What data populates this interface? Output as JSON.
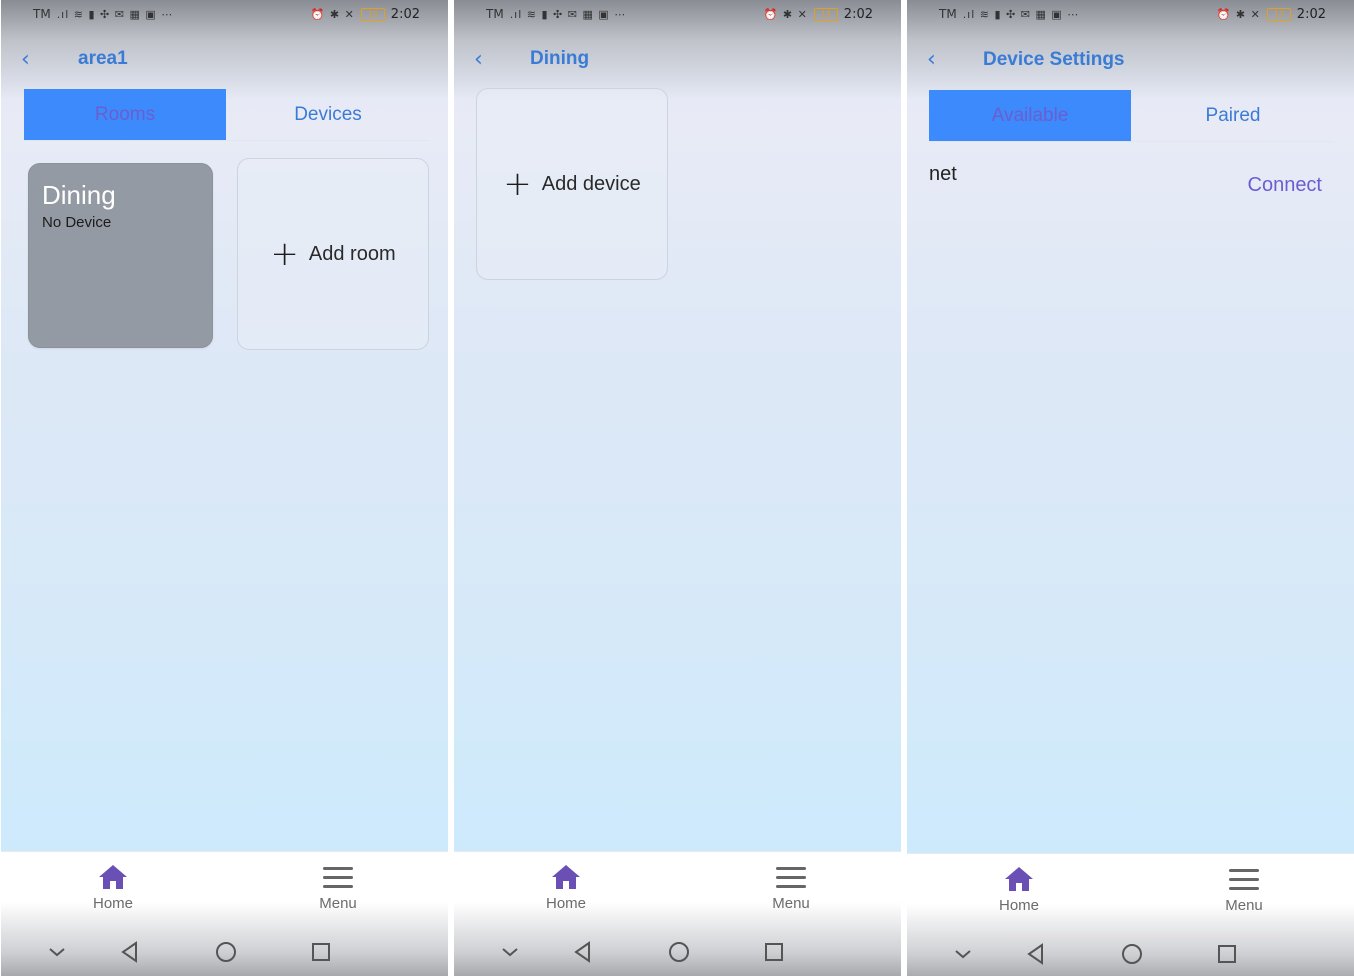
{
  "status": {
    "carrier": "TM",
    "time": "2:02",
    "battery": "13"
  },
  "screens": [
    {
      "title": "area1",
      "tabs": [
        {
          "label": "Rooms",
          "active": true
        },
        {
          "label": "Devices",
          "active": false
        }
      ],
      "room_card": {
        "name": "Dining",
        "sub": "No Device"
      },
      "add_label": "Add room"
    },
    {
      "title": "Dining",
      "add_label": "Add device"
    },
    {
      "title": "Device Settings",
      "tabs": [
        {
          "label": "Available",
          "active": true
        },
        {
          "label": "Paired",
          "active": false
        }
      ],
      "device": {
        "name": "net",
        "action": "Connect"
      }
    }
  ],
  "bottom_nav": {
    "home": "Home",
    "menu": "Menu"
  },
  "colors": {
    "accent": "#3a7bd5",
    "tab_active": "#3d8afc",
    "purple": "#6a5ed0",
    "card_grey": "#949aa3"
  }
}
